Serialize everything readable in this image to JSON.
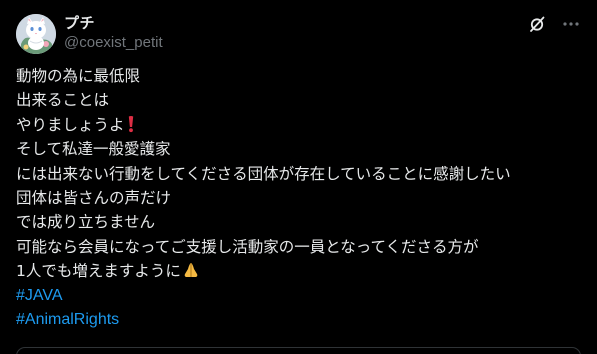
{
  "author": {
    "display_name": "プチ",
    "handle": "@coexist_petit"
  },
  "post": {
    "lines": [
      "動物の為に最低限",
      "出来ることは",
      "やりましょうよ",
      "そして私達一般愛護家",
      "には出来ない行動をしてくださる団体が存在していることに感謝したい",
      "団体は皆さんの声だけ",
      "では成り立ちません",
      "可能なら会員になってご支援し活動家の一員となってくださる方が",
      "1人でも増えますように"
    ],
    "hashtags": [
      "#JAVA",
      "#AnimalRights"
    ]
  },
  "icons": {
    "avatar": "white-cat-avatar",
    "header": [
      "grok-icon",
      "more-options-icon"
    ],
    "inline": [
      "red-exclamation-emoji",
      "folded-hands-emoji"
    ]
  },
  "colors": {
    "background": "#000000",
    "text": "#e7e9ea",
    "secondary_text": "#71767b",
    "link": "#1d9bf0",
    "exclamation": "#dd2e44",
    "hands": "#f4b942"
  }
}
